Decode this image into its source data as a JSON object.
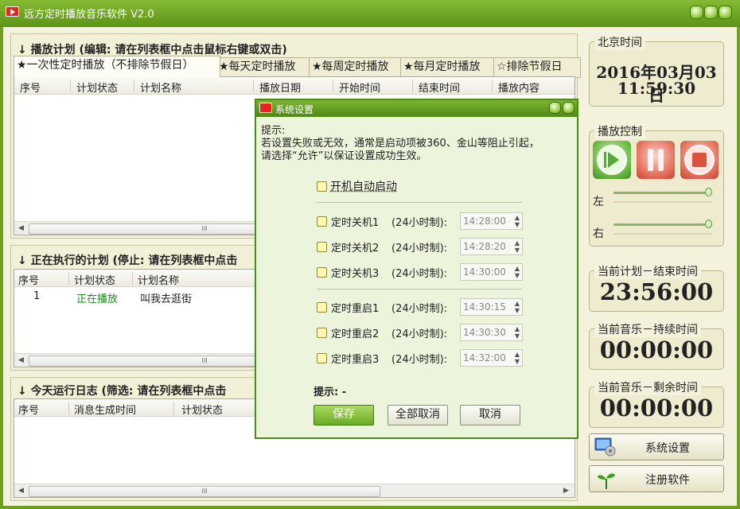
{
  "window": {
    "title": "远方定时播放音乐软件 V2.0",
    "colors": {
      "title_bar": "#5d9418",
      "client_bg": "#f4f1dc",
      "dialog_title": "#4f8915",
      "playing_text": "#1e8a1e"
    }
  },
  "plan_section": {
    "title": "播放计划 (编辑: 请在列表框中点击鼠标右键或双击)",
    "tabs": [
      "★一次性定时播放（不排除节假日）",
      "★每天定时播放",
      "★每周定时播放",
      "★每月定时播放",
      "☆排除节假日"
    ],
    "columns": [
      "序号",
      "计划状态",
      "计划名称",
      "播放日期",
      "开始时间",
      "结束时间",
      "播放内容"
    ]
  },
  "running_section": {
    "title": "正在执行的计划 (停止: 请在列表框中点击",
    "columns": [
      "序号",
      "计划状态",
      "计划名称"
    ],
    "rows": [
      {
        "index": "1",
        "status": "正在播放",
        "name": "叫我去逛街"
      }
    ]
  },
  "log_section": {
    "title": "今天运行日志 (筛选: 请在列表框中点击",
    "columns": [
      "序号",
      "消息生成时间",
      "计划状态"
    ]
  },
  "scroll_thumb_glyph": "III",
  "right_panel": {
    "clock_label": "北京时间",
    "date": "2016年03月03日",
    "time": "11:59:30",
    "play_control_label": "播放控制",
    "left_label": "左",
    "right_label": "右",
    "left_volume": 1.0,
    "right_volume": 1.0,
    "plan_end_label": "当前计划－结束时间",
    "plan_end_time": "23:56:00",
    "music_duration_label": "当前音乐－持续时间",
    "music_duration": "00:00:00",
    "music_remaining_label": "当前音乐－剩余时间",
    "music_remaining": "00:00:00",
    "settings_button": "系统设置",
    "register_button": "注册软件"
  },
  "dialog": {
    "title": "系统设置",
    "hint_title": "提示:",
    "hint_line1": "若设置失败或无效，通常是启动项被360、金山等阻止引起，",
    "hint_line2": "请选择“允许”以保证设置成功生效。",
    "autostart_label": "开机自动启动",
    "shutdown_items": [
      {
        "label": "定时关机1",
        "format": "(24小时制):",
        "value": "14:28:00"
      },
      {
        "label": "定时关机2",
        "format": "(24小时制):",
        "value": "14:28:20"
      },
      {
        "label": "定时关机3",
        "format": "(24小时制):",
        "value": "14:30:00"
      }
    ],
    "restart_items": [
      {
        "label": "定时重启1",
        "format": "(24小时制):",
        "value": "14:30:15"
      },
      {
        "label": "定时重启2",
        "format": "(24小时制):",
        "value": "14:30:30"
      },
      {
        "label": "定时重启3",
        "format": "(24小时制):",
        "value": "14:32:00"
      }
    ],
    "status_text": "提示: -",
    "save_button": "保存",
    "cancel_all_button": "全部取消",
    "cancel_button": "取消"
  }
}
